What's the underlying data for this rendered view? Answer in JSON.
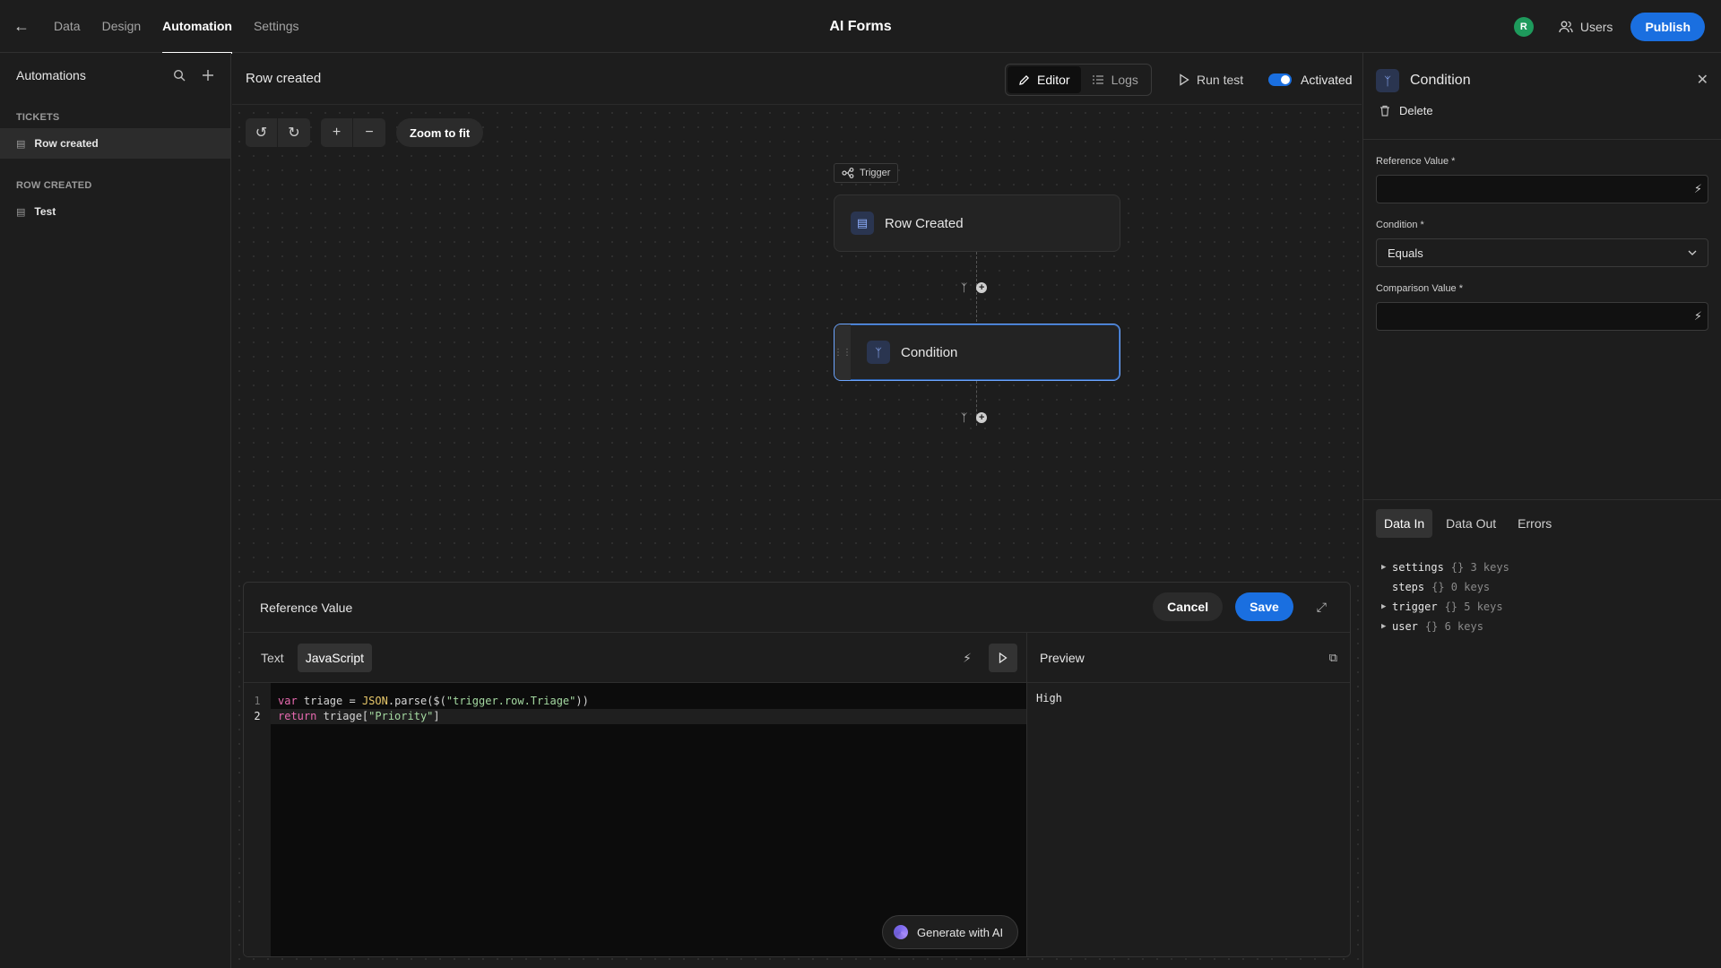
{
  "topbar": {
    "nav": [
      "Data",
      "Design",
      "Automation",
      "Settings"
    ],
    "active_nav": "Automation",
    "app_title": "AI Forms",
    "avatar_initial": "R",
    "users_label": "Users",
    "publish_label": "Publish"
  },
  "sidebar": {
    "title": "Automations",
    "groups": [
      {
        "label": "TICKETS",
        "items": [
          {
            "label": "Row created",
            "active": true
          }
        ]
      },
      {
        "label": "ROW CREATED",
        "items": [
          {
            "label": "Test",
            "active": false
          }
        ]
      }
    ]
  },
  "canvas_header": {
    "title": "Row created",
    "editor_label": "Editor",
    "logs_label": "Logs",
    "run_test_label": "Run test",
    "activated_label": "Activated",
    "activated": true
  },
  "canvas": {
    "zoom_fit_label": "Zoom to fit",
    "trigger_chip": "Trigger",
    "nodes": [
      {
        "label": "Row Created",
        "icon": "table-icon"
      },
      {
        "label": "Condition",
        "icon": "branch-icon",
        "selected": true
      }
    ]
  },
  "editor_panel": {
    "title": "Reference Value",
    "cancel_label": "Cancel",
    "save_label": "Save",
    "tabs": [
      "Text",
      "JavaScript"
    ],
    "active_tab": "JavaScript",
    "line_numbers": [
      "1",
      "2"
    ],
    "code": {
      "l1": {
        "kw": "var",
        "a": " triage = ",
        "fn": "JSON",
        "b": ".parse($(",
        "str": "\"trigger.row.Triage\"",
        "c": "))"
      },
      "l2": {
        "kw": "return",
        "a": " triage[",
        "str": "\"Priority\"",
        "c": "]"
      }
    },
    "generate_label": "Generate with AI",
    "preview_label": "Preview",
    "preview_value": "High"
  },
  "right_panel": {
    "title": "Condition",
    "delete_label": "Delete",
    "reference_label": "Reference Value *",
    "condition_label": "Condition *",
    "condition_value": "Equals",
    "comparison_label": "Comparison Value *",
    "data_tabs": [
      "Data In",
      "Data Out",
      "Errors"
    ],
    "active_data_tab": "Data In",
    "tree": [
      {
        "key": "settings",
        "meta": "{} 3 keys",
        "expandable": true
      },
      {
        "key": "steps",
        "meta": "{} 0 keys",
        "expandable": false
      },
      {
        "key": "trigger",
        "meta": "{} 5 keys",
        "expandable": true
      },
      {
        "key": "user",
        "meta": "{} 6 keys",
        "expandable": true
      }
    ]
  },
  "colors": {
    "accent": "#1a6fe0",
    "background": "#1d1d1d",
    "avatar": "#1e9a5c",
    "selected_node_border": "#6da6ff"
  }
}
